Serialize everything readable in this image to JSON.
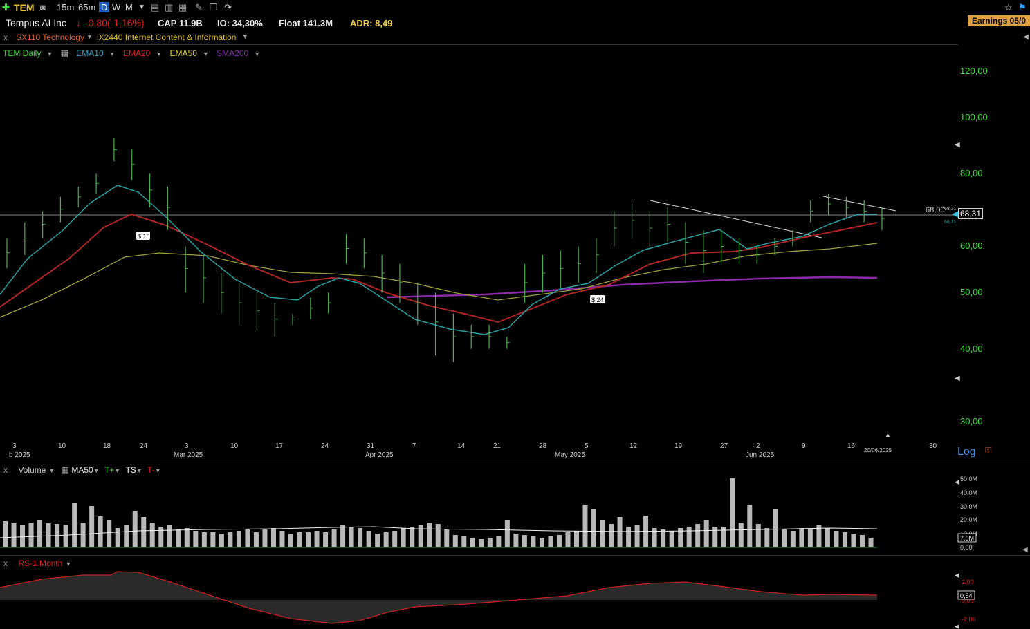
{
  "toolbar": {
    "add_icon": "plus-icon",
    "symbol": "TEM",
    "intervals": [
      "15m",
      "65m",
      "D",
      "W",
      "M"
    ],
    "active_interval": "D"
  },
  "info": {
    "company": "Tempus AI Inc",
    "change": "-0,80(-1,16%)",
    "cap": "CAP 11.9B",
    "io": "IO: 34,30%",
    "float": "Float 141.3M",
    "adr": "ADR: 8,49",
    "earnings": "Earnings 05/0"
  },
  "sector": {
    "close": "x",
    "sector": "SX110 Technology",
    "industry": "iX2440 Internet Content & Information"
  },
  "legend": {
    "main": "TEM Daily",
    "ema10": "EMA10",
    "ema20": "EMA20",
    "ema50": "EMA50",
    "sma200": "SMA200"
  },
  "price_axis": [
    "120,00",
    "100,00",
    "80,00",
    "60,00",
    "50,00",
    "40,00",
    "30,00"
  ],
  "current_price": "68,31",
  "level_label": "68,00",
  "small_labels": [
    "68,31",
    "68,11"
  ],
  "annotations": [
    "$,18",
    "$,24"
  ],
  "date_axis": {
    "days": [
      "3",
      "10",
      "18",
      "24",
      "3",
      "10",
      "17",
      "24",
      "31",
      "7",
      "14",
      "21",
      "28",
      "5",
      "12",
      "19",
      "27",
      "2",
      "9",
      "16",
      "30"
    ],
    "months": [
      "b 2025",
      "Mar 2025",
      "Apr 2025",
      "May 2025",
      "Jun 2025"
    ],
    "last_date": "20/06/2025"
  },
  "log_label": "Log",
  "volume": {
    "close": "x",
    "label": "Volume",
    "ma": "MA50",
    "t_plus": "T+",
    "ts": "TS",
    "t_minus": "T-",
    "axis": [
      "50.0M",
      "40.0M",
      "30.0M",
      "20.0M",
      "10.0M",
      "0,00"
    ],
    "current": "7.0M"
  },
  "rs": {
    "close": "x",
    "label": "RS-1 Month",
    "axis": [
      "2,00",
      "0,00",
      "-2,00"
    ],
    "current": "0,54"
  },
  "colors": {
    "up_bar": "#4caf50",
    "ema10": "#2a9d9d",
    "ema20": "#b02020",
    "ema50": "#a0a040",
    "sma200": "#8020a0",
    "price_axis": "#3ddc3d"
  },
  "chart_data": {
    "type": "line",
    "title": "TEM Daily",
    "scale": "log",
    "ylim": [
      30,
      120
    ],
    "bars_high": [
      62,
      66,
      69,
      73,
      76,
      80,
      92,
      88,
      80,
      76,
      60,
      58,
      54,
      52,
      50,
      48,
      46,
      49,
      50,
      63,
      62,
      58,
      56,
      52,
      50,
      46,
      44,
      44,
      42,
      56,
      58,
      59,
      60,
      62,
      69,
      71,
      69,
      70,
      66,
      64,
      64,
      62,
      60,
      62,
      64,
      72,
      74,
      73,
      72,
      70
    ],
    "bars_low": [
      55,
      58,
      62,
      66,
      70,
      74,
      84,
      78,
      70,
      64,
      50,
      48,
      46,
      44,
      43,
      42,
      44,
      45,
      46,
      56,
      55,
      50,
      48,
      44,
      39,
      38,
      40,
      40,
      40,
      48,
      50,
      51,
      52,
      54,
      60,
      62,
      60,
      61,
      56,
      54,
      56,
      56,
      56,
      58,
      60,
      66,
      68,
      67,
      66,
      64
    ]
  }
}
